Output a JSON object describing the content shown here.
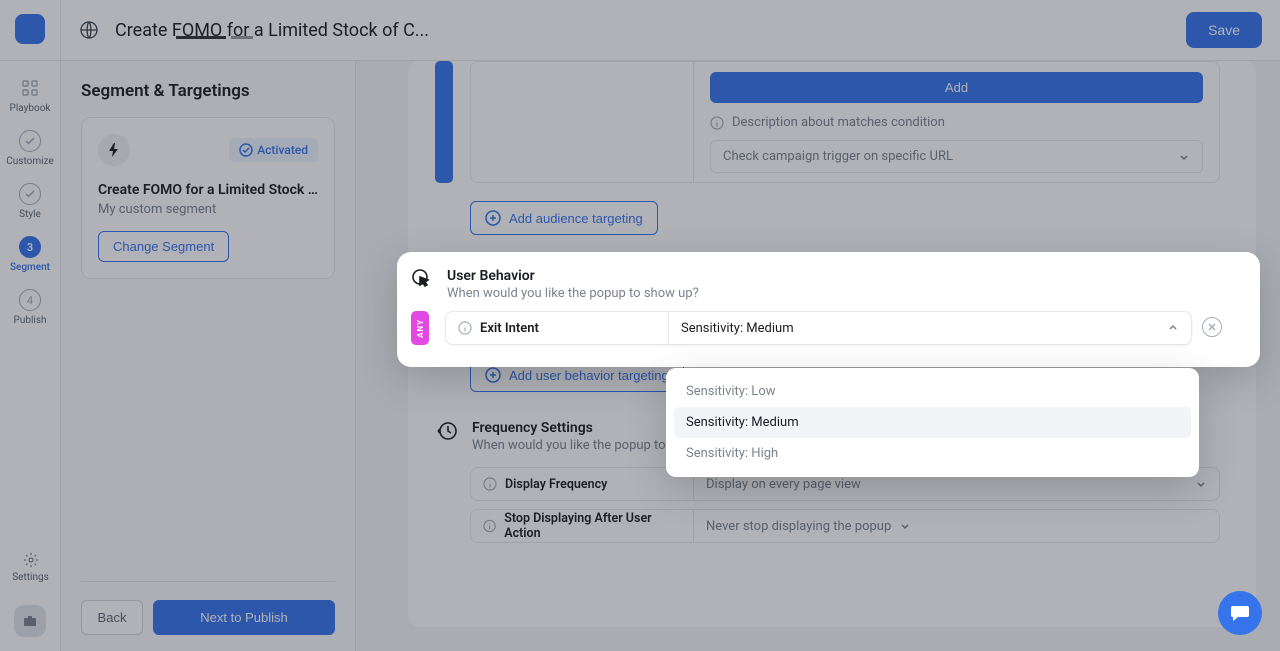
{
  "header": {
    "title": "Create FOMO for a Limited Stock of C...",
    "save": "Save"
  },
  "nav": {
    "playbook": "Playbook",
    "customize": "Customize",
    "style": "Style",
    "segment_num": "3",
    "segment": "Segment",
    "publish_num": "4",
    "publish": "Publish",
    "settings": "Settings"
  },
  "sidebar": {
    "title": "Segment & Targetings",
    "activated": "Activated",
    "card_title": "Create FOMO for a Limited Stock o...",
    "card_sub": "My custom segment",
    "change": "Change Segment",
    "back": "Back",
    "next": "Next to Publish"
  },
  "url_panel": {
    "add": "Add",
    "desc": "Description about matches condition",
    "check": "Check campaign trigger on specific URL"
  },
  "add_audience": "Add audience targeting",
  "user_behavior": {
    "title": "User Behavior",
    "sub": "When would you like the popup to show up?",
    "exit_intent": "Exit Intent",
    "any": "ANY",
    "selected": "Sensitivity: Medium",
    "options": {
      "low": "Sensitivity: Low",
      "medium": "Sensitivity: Medium",
      "high": "Sensitivity: High"
    },
    "add_btn": "Add user behavior targeting"
  },
  "frequency": {
    "title": "Frequency Settings",
    "sub": "When would you like the popup to show up?",
    "display_label": "Display Frequency",
    "display_value": "Display on every page view",
    "stop_label": "Stop Displaying After User Action",
    "stop_value": "Never stop displaying the popup"
  }
}
